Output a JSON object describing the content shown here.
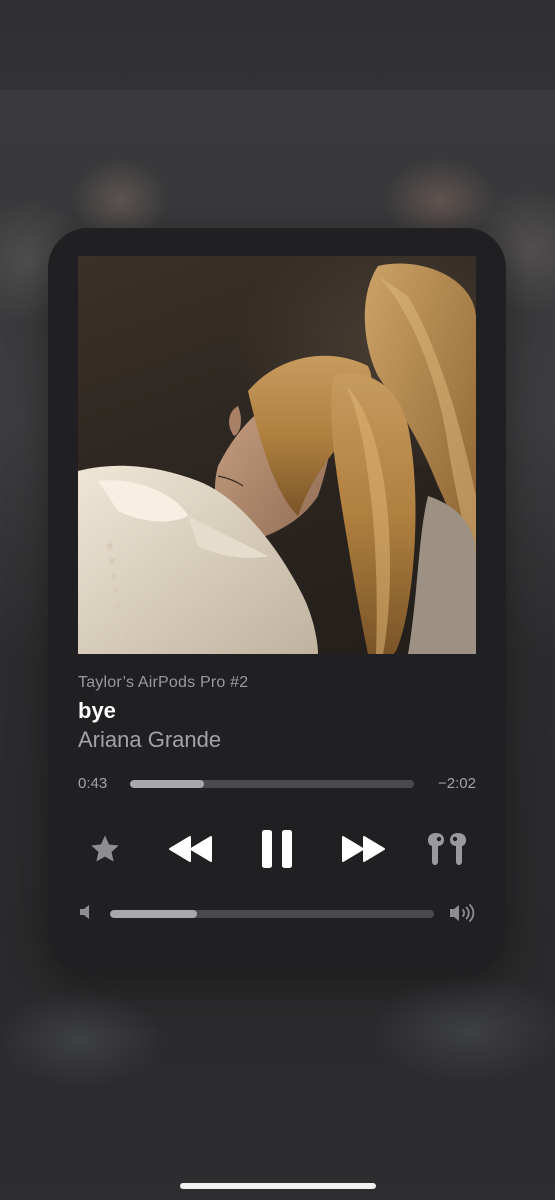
{
  "now_playing": {
    "device_label": "Taylor’s AirPods Pro #2",
    "title": "bye",
    "artist": "Ariana Grande",
    "elapsed": "0:43",
    "remaining": "−2:02",
    "progress_fraction": 0.26
  },
  "controls": {
    "favorite_icon": "star-icon",
    "rewind_icon": "rewind-icon",
    "play_pause_icon": "pause-icon",
    "forward_icon": "fast-forward-icon",
    "output_icon": "airpods-pro-icon"
  },
  "volume": {
    "level_fraction": 0.27,
    "low_icon": "speaker-low-icon",
    "high_icon": "speaker-high-icon"
  },
  "colors": {
    "card_bg": "#202022",
    "primary_text": "#ffffff",
    "secondary_text": "#a3a3a7",
    "track_bg": "#4a4a4e",
    "track_fill": "#a9a9ad"
  }
}
